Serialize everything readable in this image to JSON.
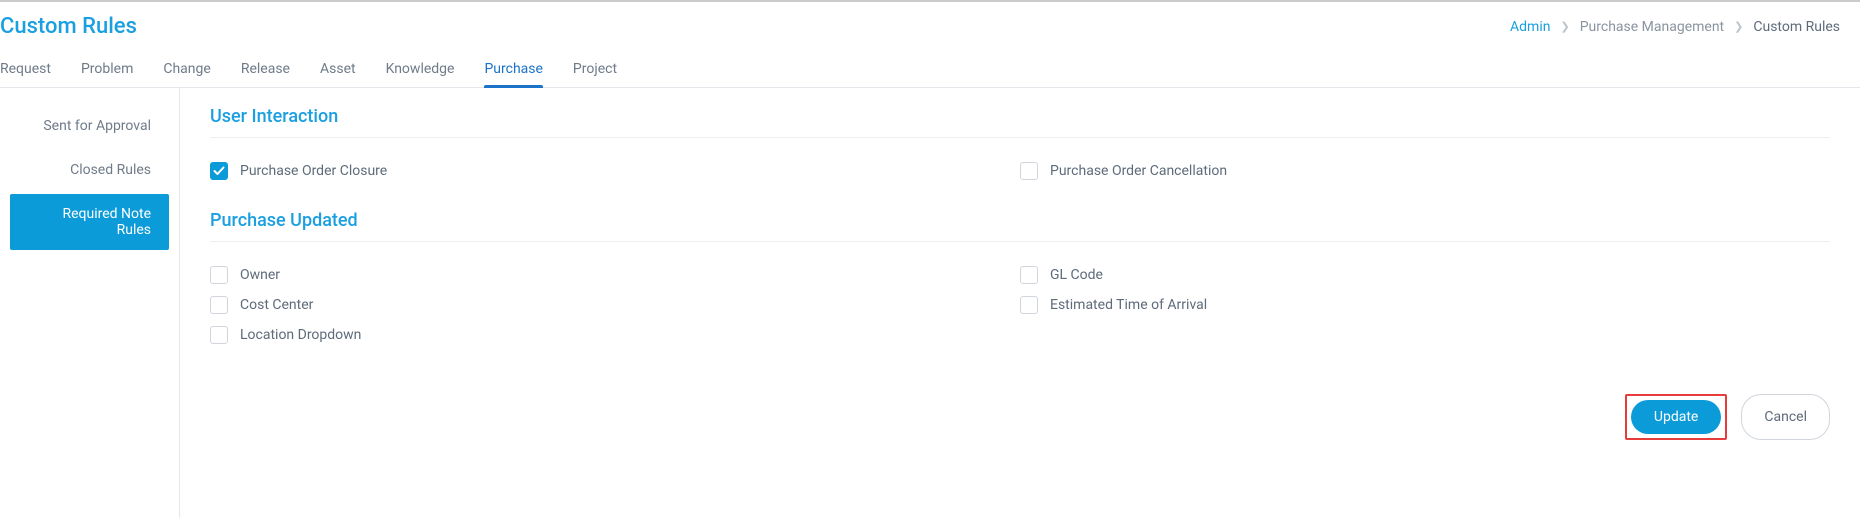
{
  "header": {
    "title": "Custom Rules"
  },
  "breadcrumb": {
    "items": [
      {
        "label": "Admin",
        "link": true
      },
      {
        "label": "Purchase Management",
        "link": false
      },
      {
        "label": "Custom Rules",
        "link": false,
        "current": true
      }
    ]
  },
  "tabs": [
    {
      "label": "Request",
      "active": false
    },
    {
      "label": "Problem",
      "active": false
    },
    {
      "label": "Change",
      "active": false
    },
    {
      "label": "Release",
      "active": false
    },
    {
      "label": "Asset",
      "active": false
    },
    {
      "label": "Knowledge",
      "active": false
    },
    {
      "label": "Purchase",
      "active": true
    },
    {
      "label": "Project",
      "active": false
    }
  ],
  "sidebar": {
    "items": [
      {
        "label": "Sent for Approval",
        "active": false
      },
      {
        "label": "Closed Rules",
        "active": false
      },
      {
        "label": "Required Note Rules",
        "active": true
      }
    ]
  },
  "sections": [
    {
      "title": "User Interaction",
      "checkboxes": [
        {
          "label": "Purchase Order Closure",
          "checked": true
        },
        {
          "label": "Purchase Order Cancellation",
          "checked": false
        }
      ]
    },
    {
      "title": "Purchase Updated",
      "checkboxes": [
        {
          "label": "Owner",
          "checked": false
        },
        {
          "label": "GL Code",
          "checked": false
        },
        {
          "label": "Cost Center",
          "checked": false
        },
        {
          "label": "Estimated Time of Arrival",
          "checked": false
        },
        {
          "label": "Location Dropdown",
          "checked": false
        }
      ]
    }
  ],
  "actions": {
    "update": "Update",
    "cancel": "Cancel"
  }
}
